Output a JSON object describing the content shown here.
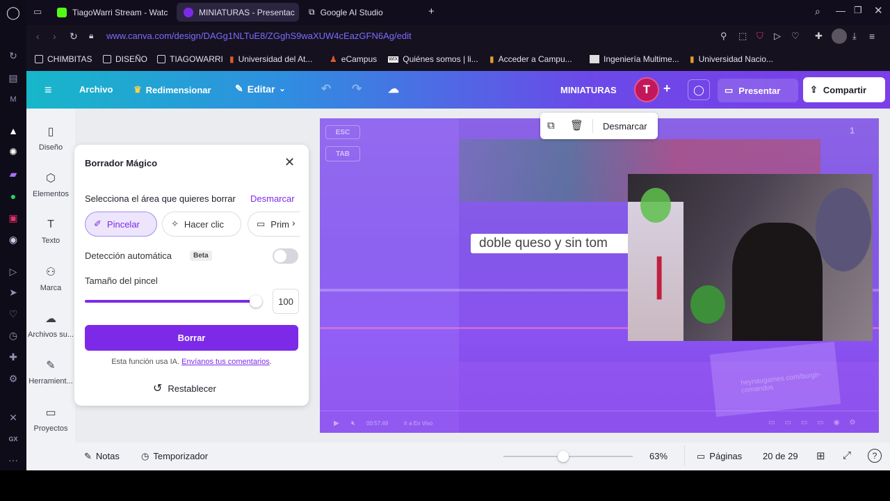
{
  "browser": {
    "tabs": [
      {
        "title": "TiagoWarri Stream - Watc",
        "favicon_color": "#53fc18"
      },
      {
        "title": "MINIATURAS - Presentac",
        "favicon_color": "#7d2ae8"
      },
      {
        "title": "Google AI Studio",
        "favicon_color": "#e8eaed"
      }
    ],
    "url": "www.canva.com/design/DAGg1NLTuE8/ZGghS9waXUW4cEazGFN6Ag/edit",
    "bookmarks": [
      "CHIMBITAS",
      "DISEÑO",
      "TIAGOWARRI",
      "Universidad del At...",
      "eCampus",
      "Quiénes somos | li...",
      "Acceder a Campu...",
      "Ingeniería Multime...",
      "Universidad Nacio..."
    ]
  },
  "header": {
    "archivo": "Archivo",
    "redimensionar": "Redimensionar",
    "editar": "Editar",
    "doc_title": "MINIATURAS",
    "avatar_letter": "T",
    "presentar": "Presentar",
    "compartir": "Compartir"
  },
  "left_nav": [
    "Diseño",
    "Elementos",
    "Texto",
    "Marca",
    "Archivos su...",
    "Herramient...",
    "Proyectos"
  ],
  "panel": {
    "title": "Borrador Mágico",
    "instruction": "Selecciona el área que quieres borrar",
    "desmarcar": "Desmarcar",
    "modes": [
      "Pincelar",
      "Hacer clic",
      "Prim"
    ],
    "auto_detect_label": "Detección automática",
    "beta": "Beta",
    "auto_detect_on": false,
    "brush_label": "Tamaño del pincel",
    "brush_value": "100",
    "brush_fraction": 1.0,
    "erase_button": "Borrar",
    "ai_note": "Esta función usa IA.",
    "feedback_link": "Envíanos tus comentarios",
    "ai_note_end": ".",
    "reset": "Restablecer"
  },
  "canvas": {
    "toolbar_desmarcar": "Desmarcar",
    "key_esc": "ESC",
    "key_tab": "TAB",
    "caption": "doble queso y sin tom",
    "page_num": "1",
    "time": "00:57:49",
    "live": "Ir a En Vivo",
    "watermark": "heynaugames.com/burgir-comandos"
  },
  "footer": {
    "notas": "Notas",
    "temporizador": "Temporizador",
    "zoom": "63%",
    "zoom_fraction": 0.46,
    "paginas": "Páginas",
    "page_count": "20 de 29"
  },
  "colors": {
    "canva_purple": "#7d2ae8",
    "url_color": "#7b6cff",
    "avatar_bg": "#c2185b"
  }
}
